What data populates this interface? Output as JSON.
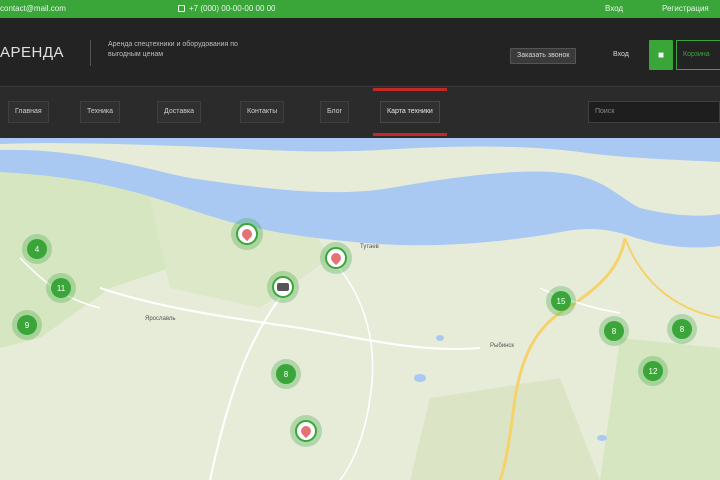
{
  "topbar": {
    "email": "contact@mail.com",
    "phone": "+7 (000) 00-00-00 00 00",
    "link1": "Вход",
    "link2": "Регистрация"
  },
  "header": {
    "logo": "АРЕНДА",
    "tagline_line1": "Аренда спецтехники и оборудования по",
    "tagline_line2": "выгодным ценам",
    "callback_label": "Заказать звонок",
    "label": "Вход",
    "cart_icon": "cart-icon",
    "cart_label": "Корзина"
  },
  "nav": {
    "items": [
      {
        "label": "Главная"
      },
      {
        "label": "Техника"
      },
      {
        "label": "Доставка"
      },
      {
        "label": "Контакты"
      },
      {
        "label": "Блог"
      },
      {
        "label": "Карта техники"
      }
    ],
    "search_placeholder": "Поиск"
  },
  "map": {
    "clusters": [
      {
        "label": "4"
      },
      {
        "label": "11"
      },
      {
        "label": "9"
      },
      {
        "label": "8"
      },
      {
        "label": "15"
      },
      {
        "label": "8"
      },
      {
        "label": "8"
      },
      {
        "label": "12"
      }
    ],
    "labels": [
      "Ярославль",
      "Тутаев",
      "Рыбинск"
    ],
    "colors": {
      "water": "#a9c9f3",
      "land": "#e7ecd9",
      "green": "#cfe3b0",
      "road": "#f5d26b",
      "accent": "#3aa63a"
    }
  }
}
